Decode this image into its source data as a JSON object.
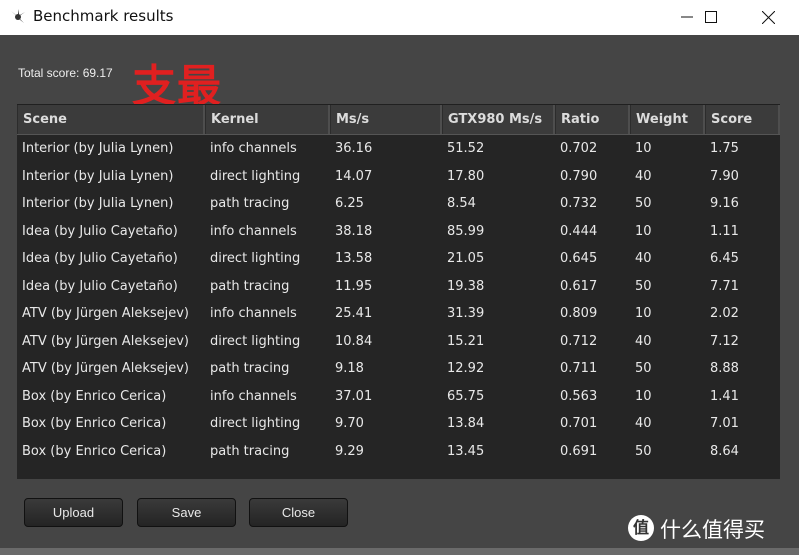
{
  "window": {
    "title": "Benchmark results",
    "controls": [
      "minimize",
      "maximize",
      "close"
    ]
  },
  "summary": {
    "total_score": "Total score: 69.17"
  },
  "watermark": {
    "overlay_text": "支最",
    "brand_badge": "值",
    "brand_text": "什么值得买"
  },
  "table": {
    "columns": [
      "Scene",
      "Kernel",
      "Ms/s",
      "GTX980 Ms/s",
      "Ratio",
      "Weight",
      "Score"
    ],
    "rows": [
      [
        "Interior (by Julia Lynen)",
        "info channels",
        "36.16",
        "51.52",
        "0.702",
        "10",
        "1.75"
      ],
      [
        "Interior (by Julia Lynen)",
        "direct lighting",
        "14.07",
        "17.80",
        "0.790",
        "40",
        "7.90"
      ],
      [
        "Interior (by Julia Lynen)",
        "path tracing",
        "6.25",
        "8.54",
        "0.732",
        "50",
        "9.16"
      ],
      [
        "Idea (by Julio Cayetaño)",
        "info channels",
        "38.18",
        "85.99",
        "0.444",
        "10",
        "1.11"
      ],
      [
        "Idea (by Julio Cayetaño)",
        "direct lighting",
        "13.58",
        "21.05",
        "0.645",
        "40",
        "6.45"
      ],
      [
        "Idea (by Julio Cayetaño)",
        "path tracing",
        "11.95",
        "19.38",
        "0.617",
        "50",
        "7.71"
      ],
      [
        "ATV (by Jürgen Aleksejev)",
        "info channels",
        "25.41",
        "31.39",
        "0.809",
        "10",
        "2.02"
      ],
      [
        "ATV (by Jürgen Aleksejev)",
        "direct lighting",
        "10.84",
        "15.21",
        "0.712",
        "40",
        "7.12"
      ],
      [
        "ATV (by Jürgen Aleksejev)",
        "path tracing",
        "9.18",
        "12.92",
        "0.711",
        "50",
        "8.88"
      ],
      [
        "Box (by Enrico Cerica)",
        "info channels",
        "37.01",
        "65.75",
        "0.563",
        "10",
        "1.41"
      ],
      [
        "Box (by Enrico Cerica)",
        "direct lighting",
        "9.70",
        "13.84",
        "0.701",
        "40",
        "7.01"
      ],
      [
        "Box (by Enrico Cerica)",
        "path tracing",
        "9.29",
        "13.45",
        "0.691",
        "50",
        "8.64"
      ]
    ]
  },
  "buttons": {
    "upload": "Upload",
    "save": "Save",
    "close": "Close"
  },
  "colors": {
    "body_bg": "#454545",
    "table_bg": "#252525",
    "header_bg": "#3b3b3b",
    "watermark_red": "#e02020"
  }
}
